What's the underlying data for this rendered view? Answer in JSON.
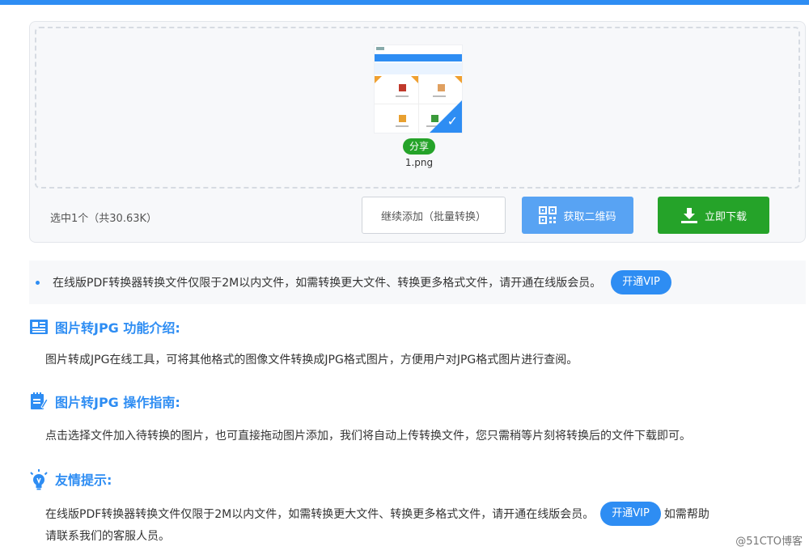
{
  "upload": {
    "file_name": "1.png",
    "share_label": "分享",
    "selected_info": "选中1个（共30.63K）",
    "continue_label": "继续添加（批量转换）",
    "qr_label": "获取二维码",
    "download_label": "立即下载"
  },
  "notice": {
    "text": "在线版PDF转换器转换文件仅限于2M以内文件，如需转换更大文件、转换更多格式文件，请开通在线版会员。",
    "vip_label": "开通VIP"
  },
  "sections": {
    "intro_title": "图片转JPG 功能介绍:",
    "intro_text": "图片转成JPG在线工具，可将其他格式的图像文件转换成JPG格式图片，方便用户对JPG格式图片进行查阅。",
    "guide_title": "图片转JPG 操作指南:",
    "guide_text": "点击选择文件加入待转换的图片，也可直接拖动图片添加，我们将自动上传转换文件，您只需稍等片刻将转换后的文件下载即可。",
    "tips_title": "友情提示:",
    "tips_text_a": "在线版PDF转换器转换文件仅限于2M以内文件，如需转换更大文件、转换更多格式文件，请开通在线版会员。",
    "tips_vip_label": "开通VIP",
    "tips_text_b": "如需帮助",
    "tips_text_c": "请联系我们的客服人员。"
  },
  "watermark": "@51CTO博客",
  "colors": {
    "accent": "#2e8df3",
    "green": "#25a329",
    "qr_blue": "#58a3f3"
  }
}
